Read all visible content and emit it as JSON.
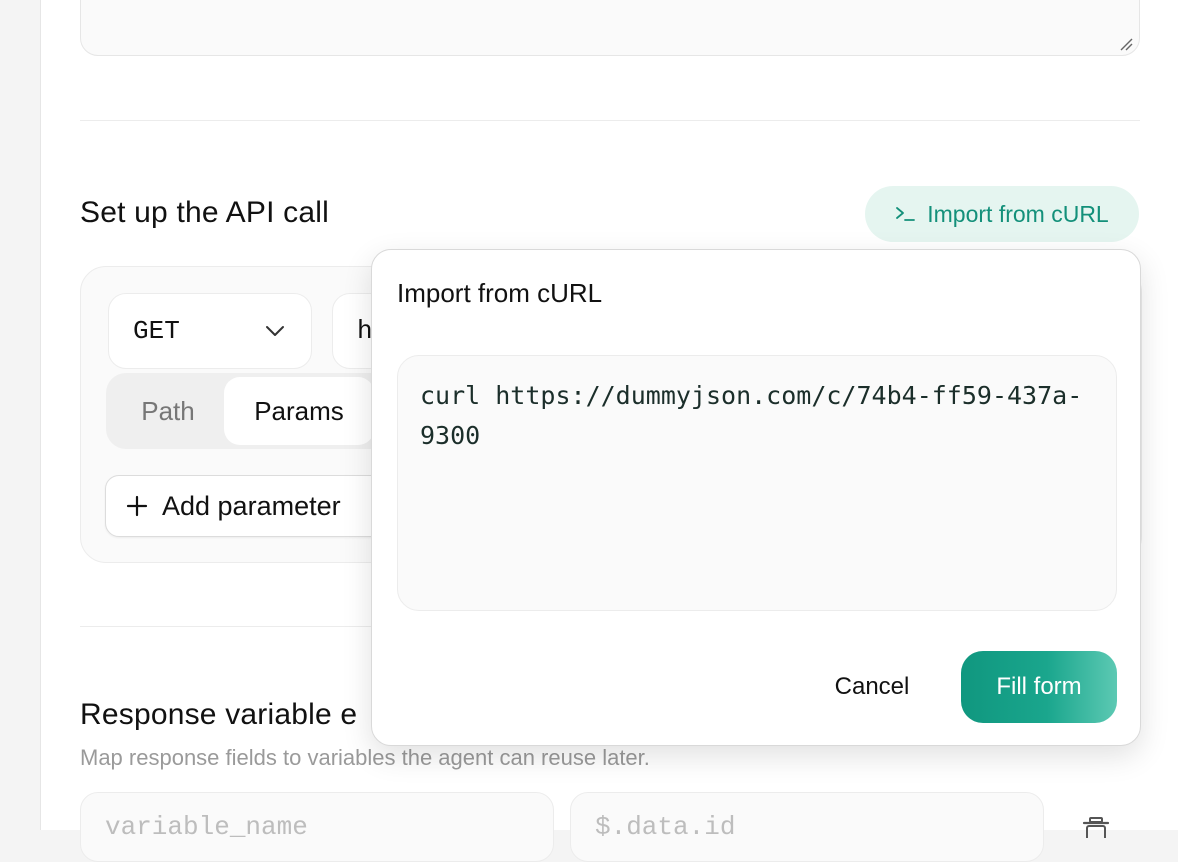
{
  "api_section": {
    "title": "Set up the API call",
    "import_button_label": "Import from cURL",
    "method": "GET",
    "url_value": "h",
    "tabs": [
      {
        "label": "Path"
      },
      {
        "label": "Params"
      }
    ],
    "active_tab": "Params",
    "add_parameter_label": "Add parameter"
  },
  "response_section": {
    "title": "Response variable e",
    "subtitle": "Map response fields to variables the agent can reuse later.",
    "variable_name_placeholder": "variable_name",
    "json_path_placeholder": "$.data.id"
  },
  "import_popover": {
    "title": "Import from cURL",
    "curl_value": "curl https://dummyjson.com/c/74b4-ff59-437a-9300",
    "cancel_label": "Cancel",
    "fill_label": "Fill form"
  },
  "colors": {
    "accent": "#13907a",
    "accent_bg": "#e5f5f0",
    "text": "#111111",
    "muted": "#9a9a9a"
  },
  "icons": {
    "import": "terminal-prompt-icon",
    "method_dropdown": "chevron-down-icon",
    "add": "plus-icon",
    "delete": "trash-icon",
    "resize": "resize-grip-icon"
  }
}
